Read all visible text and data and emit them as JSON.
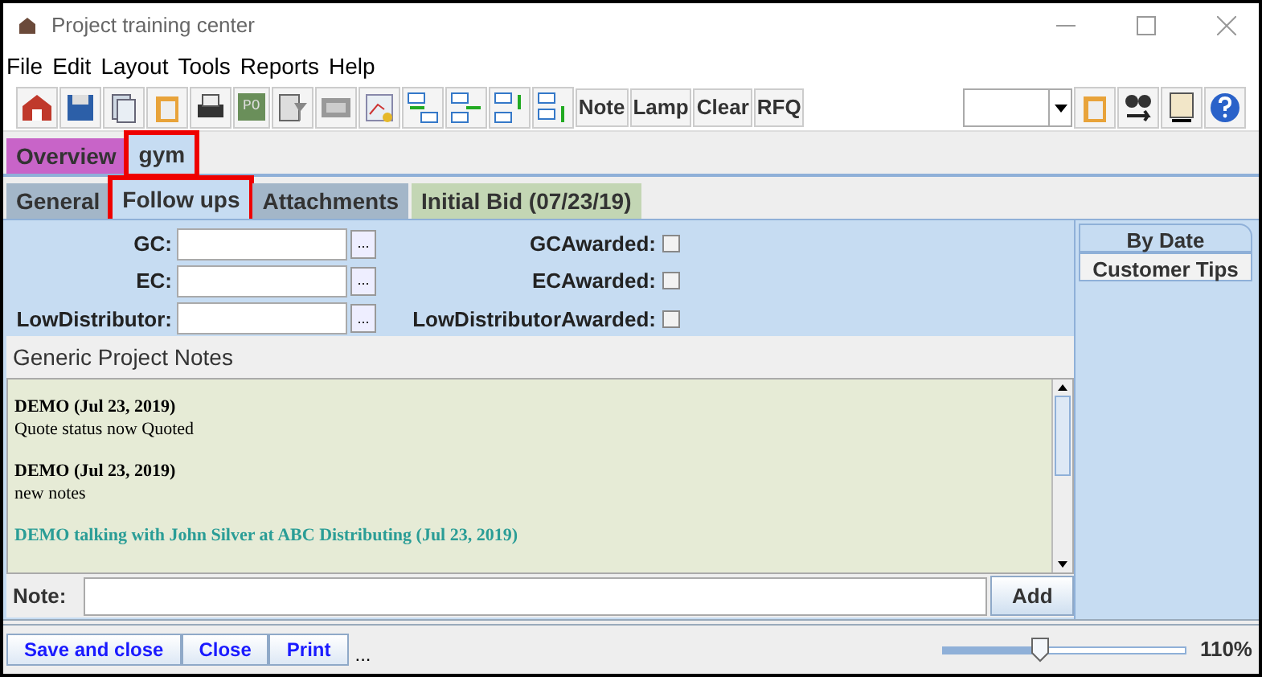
{
  "window": {
    "title": "Project training center"
  },
  "menu": [
    "File",
    "Edit",
    "Layout",
    "Tools",
    "Reports",
    "Help"
  ],
  "toolbar": {
    "po_label": "PO",
    "text_buttons": [
      "Note",
      "Lamp",
      "Clear",
      "RFQ"
    ]
  },
  "top_tabs": [
    {
      "label": "Overview",
      "selected": false,
      "highlighted": false,
      "color": "#c864c8"
    },
    {
      "label": "gym",
      "selected": true,
      "highlighted": true,
      "color": "#c6dcf2"
    }
  ],
  "sub_tabs": [
    {
      "label": "General",
      "selected": false,
      "highlighted": false,
      "color": "#a3b6c8"
    },
    {
      "label": "Follow ups",
      "selected": true,
      "highlighted": true,
      "color": "#c6dcf2"
    },
    {
      "label": "Attachments",
      "selected": false,
      "highlighted": false,
      "color": "#a3b6c8"
    },
    {
      "label": "Initial Bid (07/23/19)",
      "selected": false,
      "highlighted": false,
      "color": "#c3d6b4"
    }
  ],
  "fields": [
    {
      "label": "GC:",
      "picker": "...",
      "awarded_label": "GCAwarded:",
      "checked": false
    },
    {
      "label": "EC:",
      "picker": "...",
      "awarded_label": "ECAwarded:",
      "checked": false
    },
    {
      "label": "LowDistributor:",
      "picker": "...",
      "awarded_label": "LowDistributorAwarded:",
      "checked": false
    }
  ],
  "notes": {
    "title": "Generic Project Notes",
    "entries": [
      {
        "header": "DEMO (Jul 23, 2019)",
        "body": "Quote status now Quoted",
        "color": "#000000"
      },
      {
        "header": "DEMO (Jul 23, 2019)",
        "body": "new notes",
        "color": "#000000"
      },
      {
        "header": "DEMO talking with John Silver at ABC Distributing (Jul 23, 2019)",
        "color": "#2a9d96"
      }
    ],
    "note_label": "Note:",
    "add_button": "Add"
  },
  "side_tabs": [
    {
      "label": "By Date",
      "selected": true
    },
    {
      "label": "Customer Tips",
      "selected": false
    }
  ],
  "bottom": {
    "buttons": [
      "Save and close",
      "Close",
      "Print"
    ],
    "more": "...",
    "zoom": {
      "level": 0.4,
      "reading": "110%"
    }
  }
}
